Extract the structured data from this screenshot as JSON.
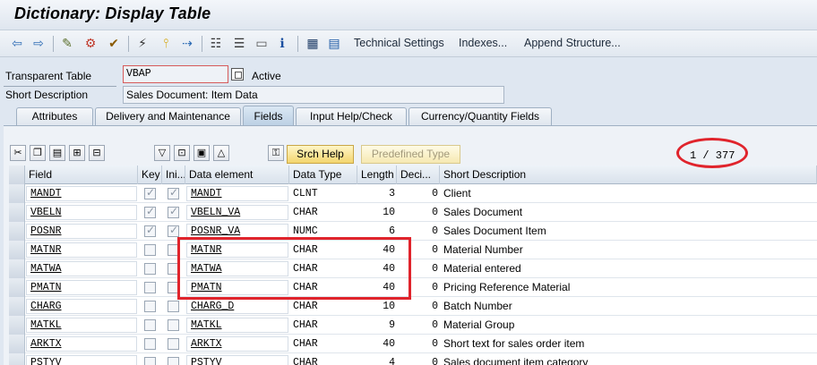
{
  "window": {
    "title": "Dictionary: Display Table"
  },
  "toolbar": {
    "icons": [
      "back-icon",
      "forward-icon",
      "display-change-icon",
      "other-object-icon",
      "check-icon",
      "activate-icon",
      "where-used-icon",
      "navigation-icon",
      "object-list-icon",
      "hierarchy-icon",
      "print-icon",
      "layout-icon",
      "info-icon",
      "tree-icon",
      "grid-icon"
    ],
    "technical_settings": "Technical Settings",
    "indexes": "Indexes...",
    "append_structure": "Append Structure..."
  },
  "header": {
    "table_type_label": "Transparent Table",
    "table_name": "VBAP",
    "status": "Active",
    "short_desc_label": "Short Description",
    "short_desc_value": "Sales Document: Item Data"
  },
  "tabs": [
    {
      "label": "Attributes",
      "active": false
    },
    {
      "label": "Delivery and Maintenance",
      "active": false
    },
    {
      "label": "Fields",
      "active": true
    },
    {
      "label": "Input Help/Check",
      "active": false
    },
    {
      "label": "Currency/Quantity Fields",
      "active": false
    }
  ],
  "fields_toolbar": {
    "srch_help": "Srch Help",
    "predefined_type": "Predefined Type",
    "counter": "1  /  377"
  },
  "columns": [
    "Field",
    "Key",
    "Ini...",
    "Data element",
    "Data Type",
    "Length",
    "Deci...",
    "Short Description"
  ],
  "rows": [
    {
      "field": "MANDT",
      "key": true,
      "init": true,
      "data_element": "MANDT",
      "data_type": "CLNT",
      "length": "3",
      "decimals": "0",
      "desc": "Client"
    },
    {
      "field": "VBELN",
      "key": true,
      "init": true,
      "data_element": "VBELN_VA",
      "data_type": "CHAR",
      "length": "10",
      "decimals": "0",
      "desc": "Sales Document"
    },
    {
      "field": "POSNR",
      "key": true,
      "init": true,
      "data_element": "POSNR_VA",
      "data_type": "NUMC",
      "length": "6",
      "decimals": "0",
      "desc": "Sales Document Item"
    },
    {
      "field": "MATNR",
      "key": false,
      "init": false,
      "data_element": "MATNR",
      "data_type": "CHAR",
      "length": "40",
      "decimals": "0",
      "desc": "Material Number"
    },
    {
      "field": "MATWA",
      "key": false,
      "init": false,
      "data_element": "MATWA",
      "data_type": "CHAR",
      "length": "40",
      "decimals": "0",
      "desc": "Material entered"
    },
    {
      "field": "PMATN",
      "key": false,
      "init": false,
      "data_element": "PMATN",
      "data_type": "CHAR",
      "length": "40",
      "decimals": "0",
      "desc": "Pricing Reference Material"
    },
    {
      "field": "CHARG",
      "key": false,
      "init": false,
      "data_element": "CHARG_D",
      "data_type": "CHAR",
      "length": "10",
      "decimals": "0",
      "desc": "Batch Number"
    },
    {
      "field": "MATKL",
      "key": false,
      "init": false,
      "data_element": "MATKL",
      "data_type": "CHAR",
      "length": "9",
      "decimals": "0",
      "desc": "Material Group"
    },
    {
      "field": "ARKTX",
      "key": false,
      "init": false,
      "data_element": "ARKTX",
      "data_type": "CHAR",
      "length": "40",
      "decimals": "0",
      "desc": "Short text for sales order item"
    },
    {
      "field": "PSTYV",
      "key": false,
      "init": false,
      "data_element": "PSTYV",
      "data_type": "CHAR",
      "length": "4",
      "decimals": "0",
      "desc": "Sales document item category"
    }
  ],
  "annotations": {
    "highlight_color": "#e0242c"
  }
}
